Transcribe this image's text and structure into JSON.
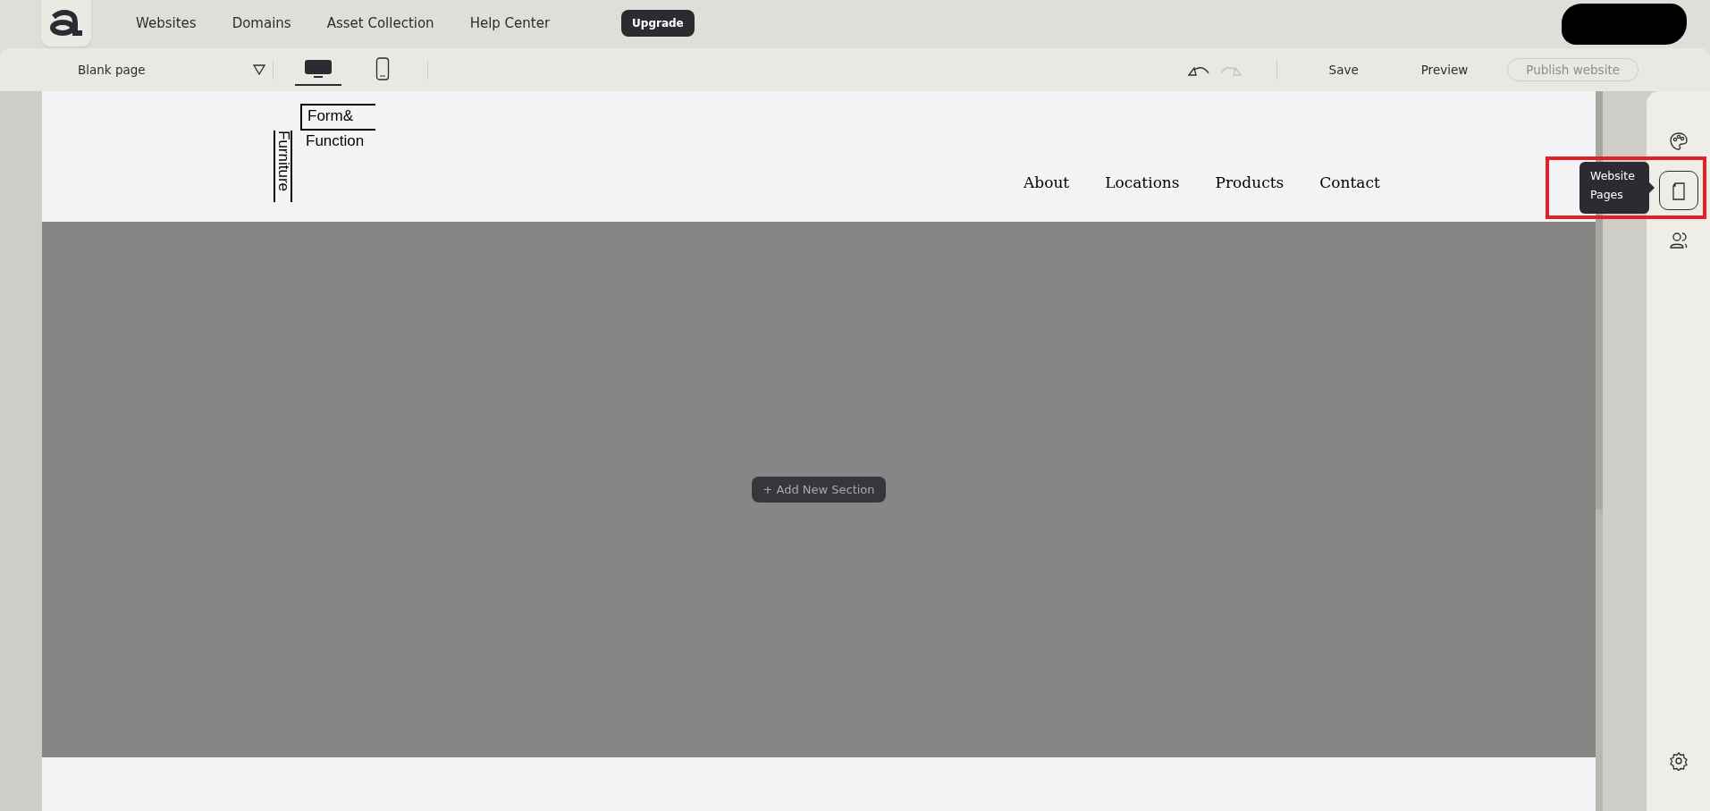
{
  "top_nav": {
    "items": [
      "Websites",
      "Domains",
      "Asset Collection",
      "Help Center"
    ],
    "upgrade": "Upgrade"
  },
  "toolbar": {
    "page_select": "Blank page",
    "devices": [
      {
        "kind": "desktop",
        "selected": true
      },
      {
        "kind": "mobile",
        "selected": false
      }
    ],
    "history": [
      {
        "kind": "undo",
        "disabled": false
      },
      {
        "kind": "redo",
        "disabled": true
      }
    ],
    "save": "Save",
    "preview": "Preview",
    "publish": {
      "label": "Publish website",
      "disabled": true
    }
  },
  "site": {
    "logo": {
      "top": "Form&",
      "right": "Function",
      "side": "Furniture"
    },
    "menu": [
      "About",
      "Locations",
      "Products",
      "Contact"
    ],
    "add_section": "+ Add New Section"
  },
  "sidebar": {
    "tools": [
      {
        "kind": "palette",
        "selected": false
      },
      {
        "kind": "pages",
        "selected": true
      },
      {
        "kind": "people",
        "selected": false
      },
      {
        "kind": "settings",
        "selected": false
      }
    ],
    "tooltip": "Website Pages"
  }
}
